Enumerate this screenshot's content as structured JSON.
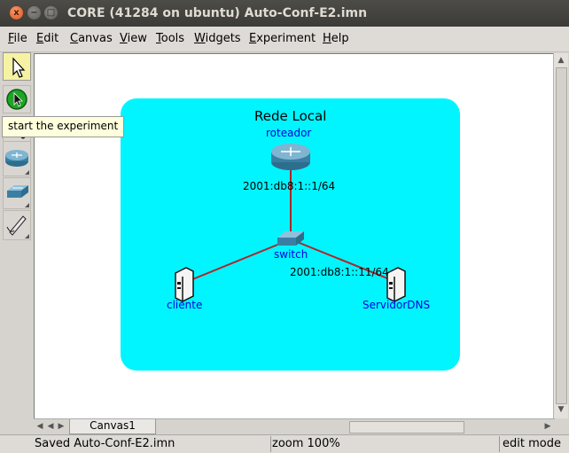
{
  "window": {
    "title": "CORE (41284 on ubuntu) Auto-Conf-E2.imn",
    "close_glyph": "x",
    "min_glyph": "−",
    "max_glyph": "□"
  },
  "menu": {
    "items": [
      {
        "u": "F",
        "rest": "ile"
      },
      {
        "u": "E",
        "rest": "dit"
      },
      {
        "u": "C",
        "rest": "anvas"
      },
      {
        "u": "V",
        "rest": "iew"
      },
      {
        "u": "T",
        "rest": "ools"
      },
      {
        "u": "W",
        "rest": "idgets"
      },
      {
        "u": "E",
        "rest": "xperiment"
      },
      {
        "u": "H",
        "rest": "elp"
      }
    ]
  },
  "toolbar": {
    "tools": [
      "select-tool",
      "start-experiment-tool",
      "link-tool",
      "router-tool",
      "switch-tool",
      "annotation-tool"
    ],
    "tooltip": "start the experiment"
  },
  "canvas": {
    "region_label": "Rede Local",
    "nodes": {
      "router": "roteador",
      "switch": "switch",
      "client": "cliente",
      "dns": "ServidorDNS"
    },
    "addresses": {
      "router_link": "2001:db8:1::1/64",
      "dns_link": "2001:db8:1::11/64"
    },
    "colors": {
      "region": "#00f5ff",
      "link": "#b0252a",
      "node_label": "#0000dd"
    }
  },
  "tabs": {
    "canvas_tab": "Canvas1"
  },
  "status": {
    "message": "Saved Auto-Conf-E2.imn",
    "zoom": "zoom 100%",
    "mode": "edit mode"
  }
}
